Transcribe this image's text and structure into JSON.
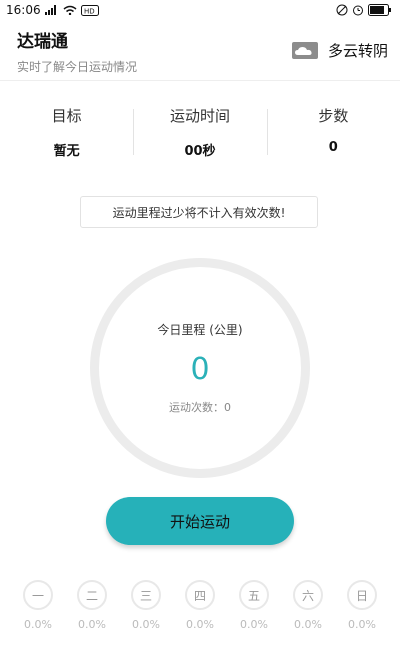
{
  "statusbar": {
    "time": "16:06",
    "left_icons": [
      "signal-icon",
      "wifi-icon",
      "hd-icon"
    ],
    "right_icons": [
      "silent-icon",
      "alarm-icon",
      "battery-icon"
    ]
  },
  "header": {
    "title": "达瑞通",
    "subtitle": "实时了解今日运动情况",
    "weather_icon": "cloud-icon",
    "weather": "多云转阴"
  },
  "stats": [
    {
      "label": "目标",
      "value": "暂无"
    },
    {
      "label": "运动时间",
      "value": "00秒"
    },
    {
      "label": "步数",
      "value": "0"
    }
  ],
  "notice": "运动里程过少将不计入有效次数!",
  "ring": {
    "label": "今日里程 (公里)",
    "value": "0",
    "count_label": "运动次数：0"
  },
  "start_button": "开始运动",
  "week": [
    {
      "day": "一",
      "pct": "0.0%"
    },
    {
      "day": "二",
      "pct": "0.0%"
    },
    {
      "day": "三",
      "pct": "0.0%"
    },
    {
      "day": "四",
      "pct": "0.0%"
    },
    {
      "day": "五",
      "pct": "0.0%"
    },
    {
      "day": "六",
      "pct": "0.0%"
    },
    {
      "day": "日",
      "pct": "0.0%"
    }
  ],
  "colors": {
    "accent": "#26b1b9",
    "value_text": "#2bb1b8",
    "ring": "#ececec"
  }
}
